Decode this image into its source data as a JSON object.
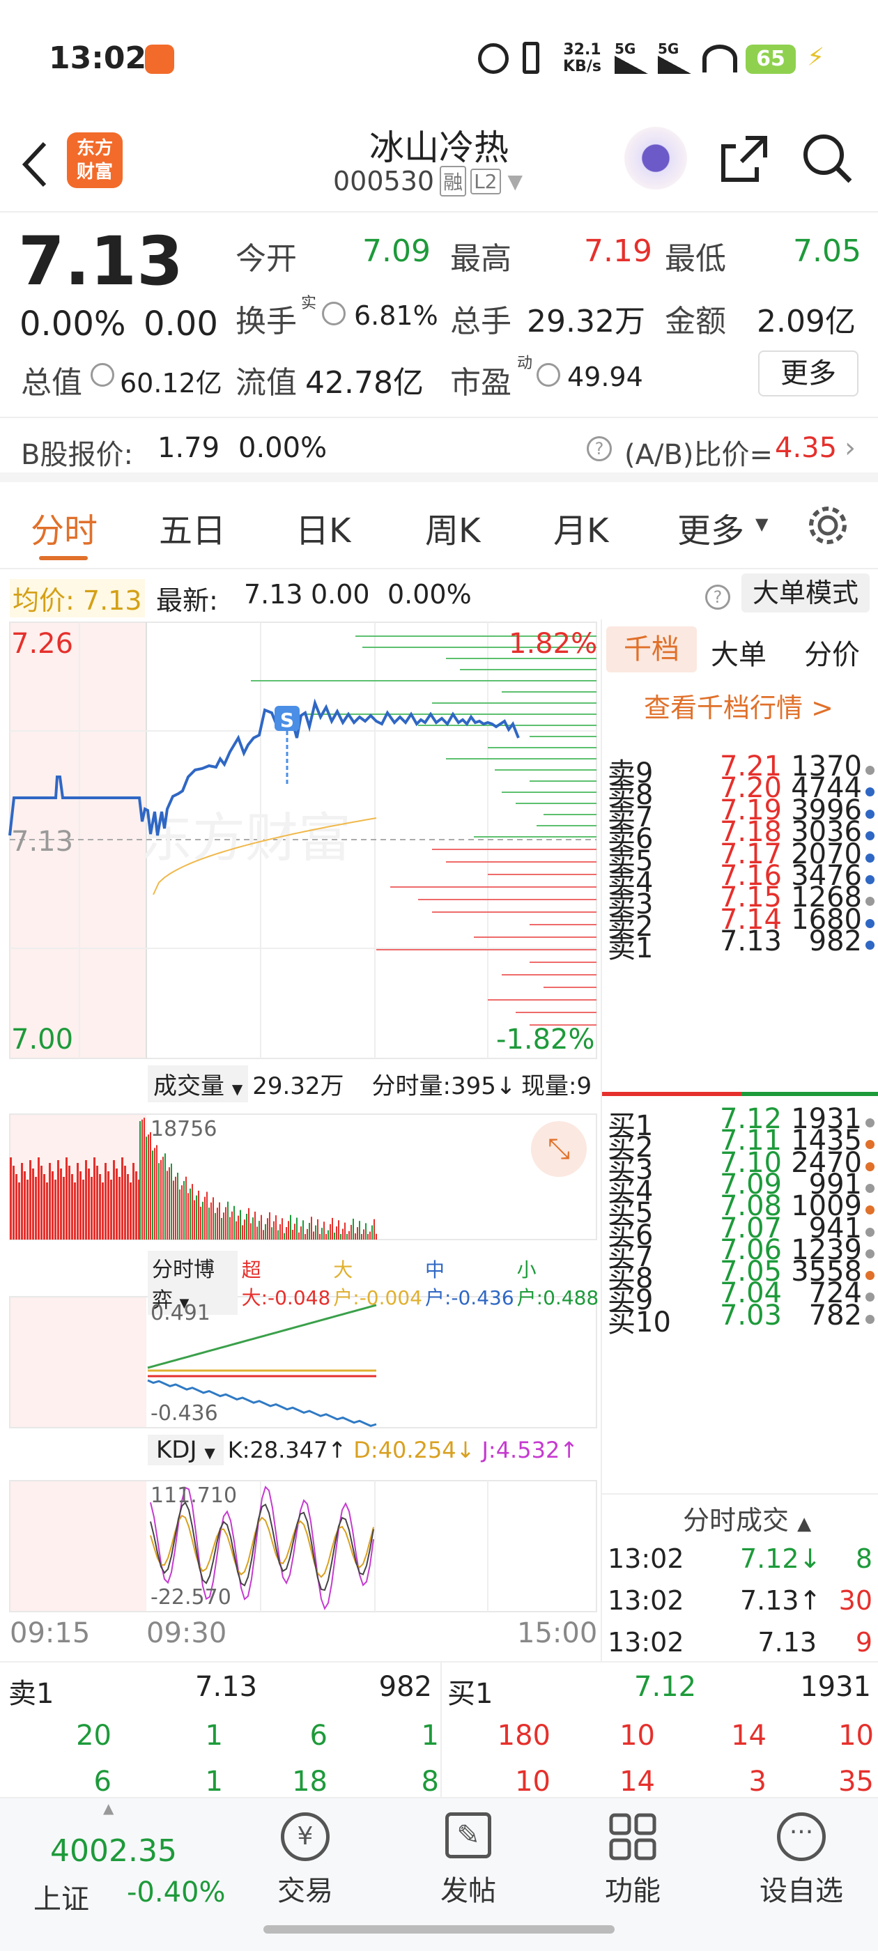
{
  "status_bar": {
    "time": "13:02",
    "net_speed": "32.1",
    "net_unit": "KB/s",
    "sig1": "5G",
    "sig2": "5G",
    "battery": "65"
  },
  "header": {
    "logo_line1": "东方",
    "logo_line2": "财富",
    "stock_name": "冰山冷热",
    "stock_code": "000530",
    "tag_rong": "融",
    "tag_l2": "L2"
  },
  "quote": {
    "price": "7.13",
    "change_pct": "0.00%",
    "change": "0.00",
    "open_label": "今开",
    "open": "7.09",
    "high_label": "最高",
    "high": "7.19",
    "low_label": "最低",
    "low": "7.05",
    "turnover_label": "换手",
    "turnover_sup": "实",
    "turnover": "6.81%",
    "volume_label": "总手",
    "volume": "29.32万",
    "amount_label": "金额",
    "amount": "2.09亿",
    "mcap_label": "总值",
    "mcap": "60.12亿",
    "float_label": "流值",
    "float_cap": "42.78亿",
    "pe_label": "市盈",
    "pe_sup": "动",
    "pe": "49.94",
    "more_btn": "更多"
  },
  "bshare": {
    "label": "B股报价:",
    "price": "1.79",
    "pct": "0.00%",
    "ratio_label": "(A/B)比价=",
    "ratio": "4.35"
  },
  "tabs": [
    "分时",
    "五日",
    "日K",
    "周K",
    "月K",
    "更多"
  ],
  "avg_line": {
    "avg_label": "均价:",
    "avg": "7.13",
    "latest_label": "最新:",
    "latest": "7.13",
    "chg": "0.00",
    "pct": "0.00%",
    "mode_btn": "大单模式"
  },
  "chart": {
    "price_high": "7.26",
    "price_mid": "7.13",
    "price_low": "7.00",
    "pct_high": "1.82%",
    "pct_low": "-1.82%",
    "signal": "S",
    "vol_selector": "成交量",
    "vol_total": "29.32万",
    "vol_tick_label": "分时量:395↓",
    "vol_now": "现量:9",
    "vol_max": "18756",
    "game_selector": "分时博弈",
    "super": "超大:-0.048",
    "big": "大户:-0.004",
    "mid": "中户:-0.436",
    "small": "小户:0.488",
    "game_high": "0.491",
    "game_low": "-0.436",
    "kdj_selector": "KDJ",
    "k_val": "K:28.347↑",
    "d_val": "D:40.254↓",
    "j_val": "J:4.532↑",
    "kdj_high": "111.710",
    "kdj_low": "-22.570",
    "t_start": "09:15",
    "t_open": "09:30",
    "t_end": "15:00"
  },
  "panel": {
    "tabs": [
      "千档",
      "大单",
      "分价"
    ],
    "link": "查看千档行情 >",
    "sells": [
      {
        "label": "卖9",
        "price": "7.21",
        "vol": "1370",
        "dot": "#999"
      },
      {
        "label": "卖8",
        "price": "7.20",
        "vol": "4744",
        "dot": "#2f67c4"
      },
      {
        "label": "卖7",
        "price": "7.19",
        "vol": "3996",
        "dot": "#2f67c4"
      },
      {
        "label": "卖6",
        "price": "7.18",
        "vol": "3036",
        "dot": "#2f67c4"
      },
      {
        "label": "卖5",
        "price": "7.17",
        "vol": "2070",
        "dot": "#2f67c4"
      },
      {
        "label": "卖4",
        "price": "7.16",
        "vol": "3476",
        "dot": "#2f67c4"
      },
      {
        "label": "卖3",
        "price": "7.15",
        "vol": "1268",
        "dot": "#999"
      },
      {
        "label": "卖2",
        "price": "7.14",
        "vol": "1680",
        "dot": "#2f67c4"
      },
      {
        "label": "卖1",
        "price": "7.13",
        "vol": "982",
        "dot": "#2f67c4"
      }
    ],
    "buys": [
      {
        "label": "买1",
        "price": "7.12",
        "vol": "1931",
        "dot": "#999"
      },
      {
        "label": "买2",
        "price": "7.11",
        "vol": "1435",
        "dot": "#e0702a"
      },
      {
        "label": "买3",
        "price": "7.10",
        "vol": "2470",
        "dot": "#e0702a"
      },
      {
        "label": "买4",
        "price": "7.09",
        "vol": "991",
        "dot": "#999"
      },
      {
        "label": "买5",
        "price": "7.08",
        "vol": "1009",
        "dot": "#e0702a"
      },
      {
        "label": "买6",
        "price": "7.07",
        "vol": "941",
        "dot": "#999"
      },
      {
        "label": "买7",
        "price": "7.06",
        "vol": "1239",
        "dot": "#999"
      },
      {
        "label": "买8",
        "price": "7.05",
        "vol": "3558",
        "dot": "#e0702a"
      },
      {
        "label": "买9",
        "price": "7.04",
        "vol": "724",
        "dot": "#999"
      },
      {
        "label": "买10",
        "price": "7.03",
        "vol": "782",
        "dot": "#999"
      }
    ],
    "ticks_title": "分时成交",
    "ticks": [
      {
        "time": "13:02",
        "price": "7.12↓",
        "vol": "8"
      },
      {
        "time": "13:02",
        "price": "7.13↑",
        "vol": "30"
      },
      {
        "time": "13:02",
        "price": "7.13",
        "vol": "9"
      }
    ]
  },
  "bottom": {
    "sell_label": "卖1",
    "sell_price": "7.13",
    "sell_vol": "982",
    "buy_label": "买1",
    "buy_price": "7.12",
    "buy_vol": "1931",
    "row1_left": [
      "20",
      "1",
      "6",
      "1"
    ],
    "row1_right": [
      "180",
      "10",
      "14",
      "10"
    ],
    "row2_left": [
      "6",
      "1",
      "18",
      "8"
    ],
    "row2_right": [
      "10",
      "14",
      "3",
      "35"
    ]
  },
  "navbar": {
    "index_val": "4002.35",
    "index_name": "上证",
    "index_chg": "-0.40%",
    "items": [
      "交易",
      "发帖",
      "功能",
      "设自选"
    ]
  }
}
